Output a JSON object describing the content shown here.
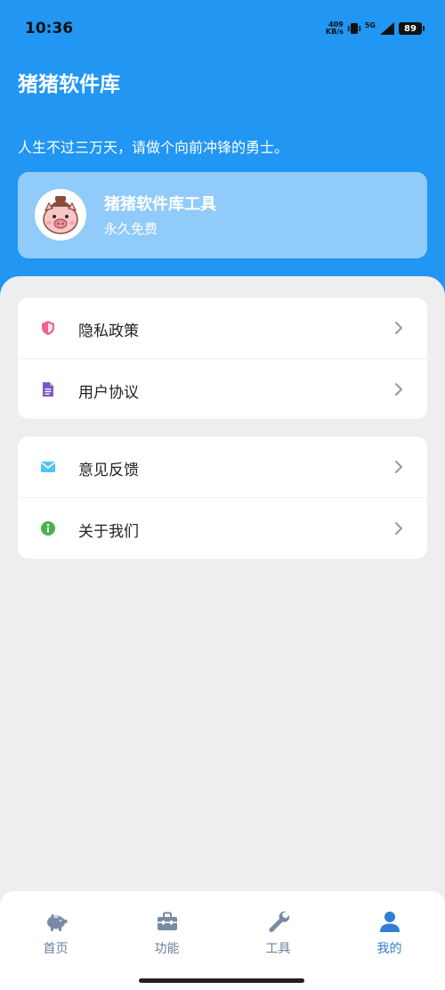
{
  "status_bar": {
    "time": "10:36",
    "net_speed_value": "409",
    "net_speed_unit": "KB/s",
    "network": "5G",
    "battery": "89"
  },
  "header": {
    "title": "猪猪软件库",
    "slogan": "人生不过三万天，请做个向前冲锋的勇士。"
  },
  "profile": {
    "name": "猪猪软件库工具",
    "subtitle": "永久免费",
    "avatar_icon": "pig-avatar"
  },
  "menu_groups": [
    {
      "items": [
        {
          "label": "隐私政策",
          "icon": "shield-icon",
          "color": "#F06292"
        },
        {
          "label": "用户协议",
          "icon": "document-icon",
          "color": "#7E57C2"
        }
      ]
    },
    {
      "items": [
        {
          "label": "意见反馈",
          "icon": "mail-icon",
          "color": "#4FC3F7"
        },
        {
          "label": "关于我们",
          "icon": "info-icon",
          "color": "#4CAF50"
        }
      ]
    }
  ],
  "tabbar": {
    "tabs": [
      {
        "label": "首页",
        "icon": "piggy-bank-icon"
      },
      {
        "label": "功能",
        "icon": "toolbox-icon"
      },
      {
        "label": "工具",
        "icon": "wrench-icon"
      },
      {
        "label": "我的",
        "icon": "user-icon",
        "active": true
      }
    ]
  },
  "colors": {
    "primary": "#2196F3",
    "tab_inactive": "#6a7fa0",
    "tab_active": "#2f80d4"
  }
}
